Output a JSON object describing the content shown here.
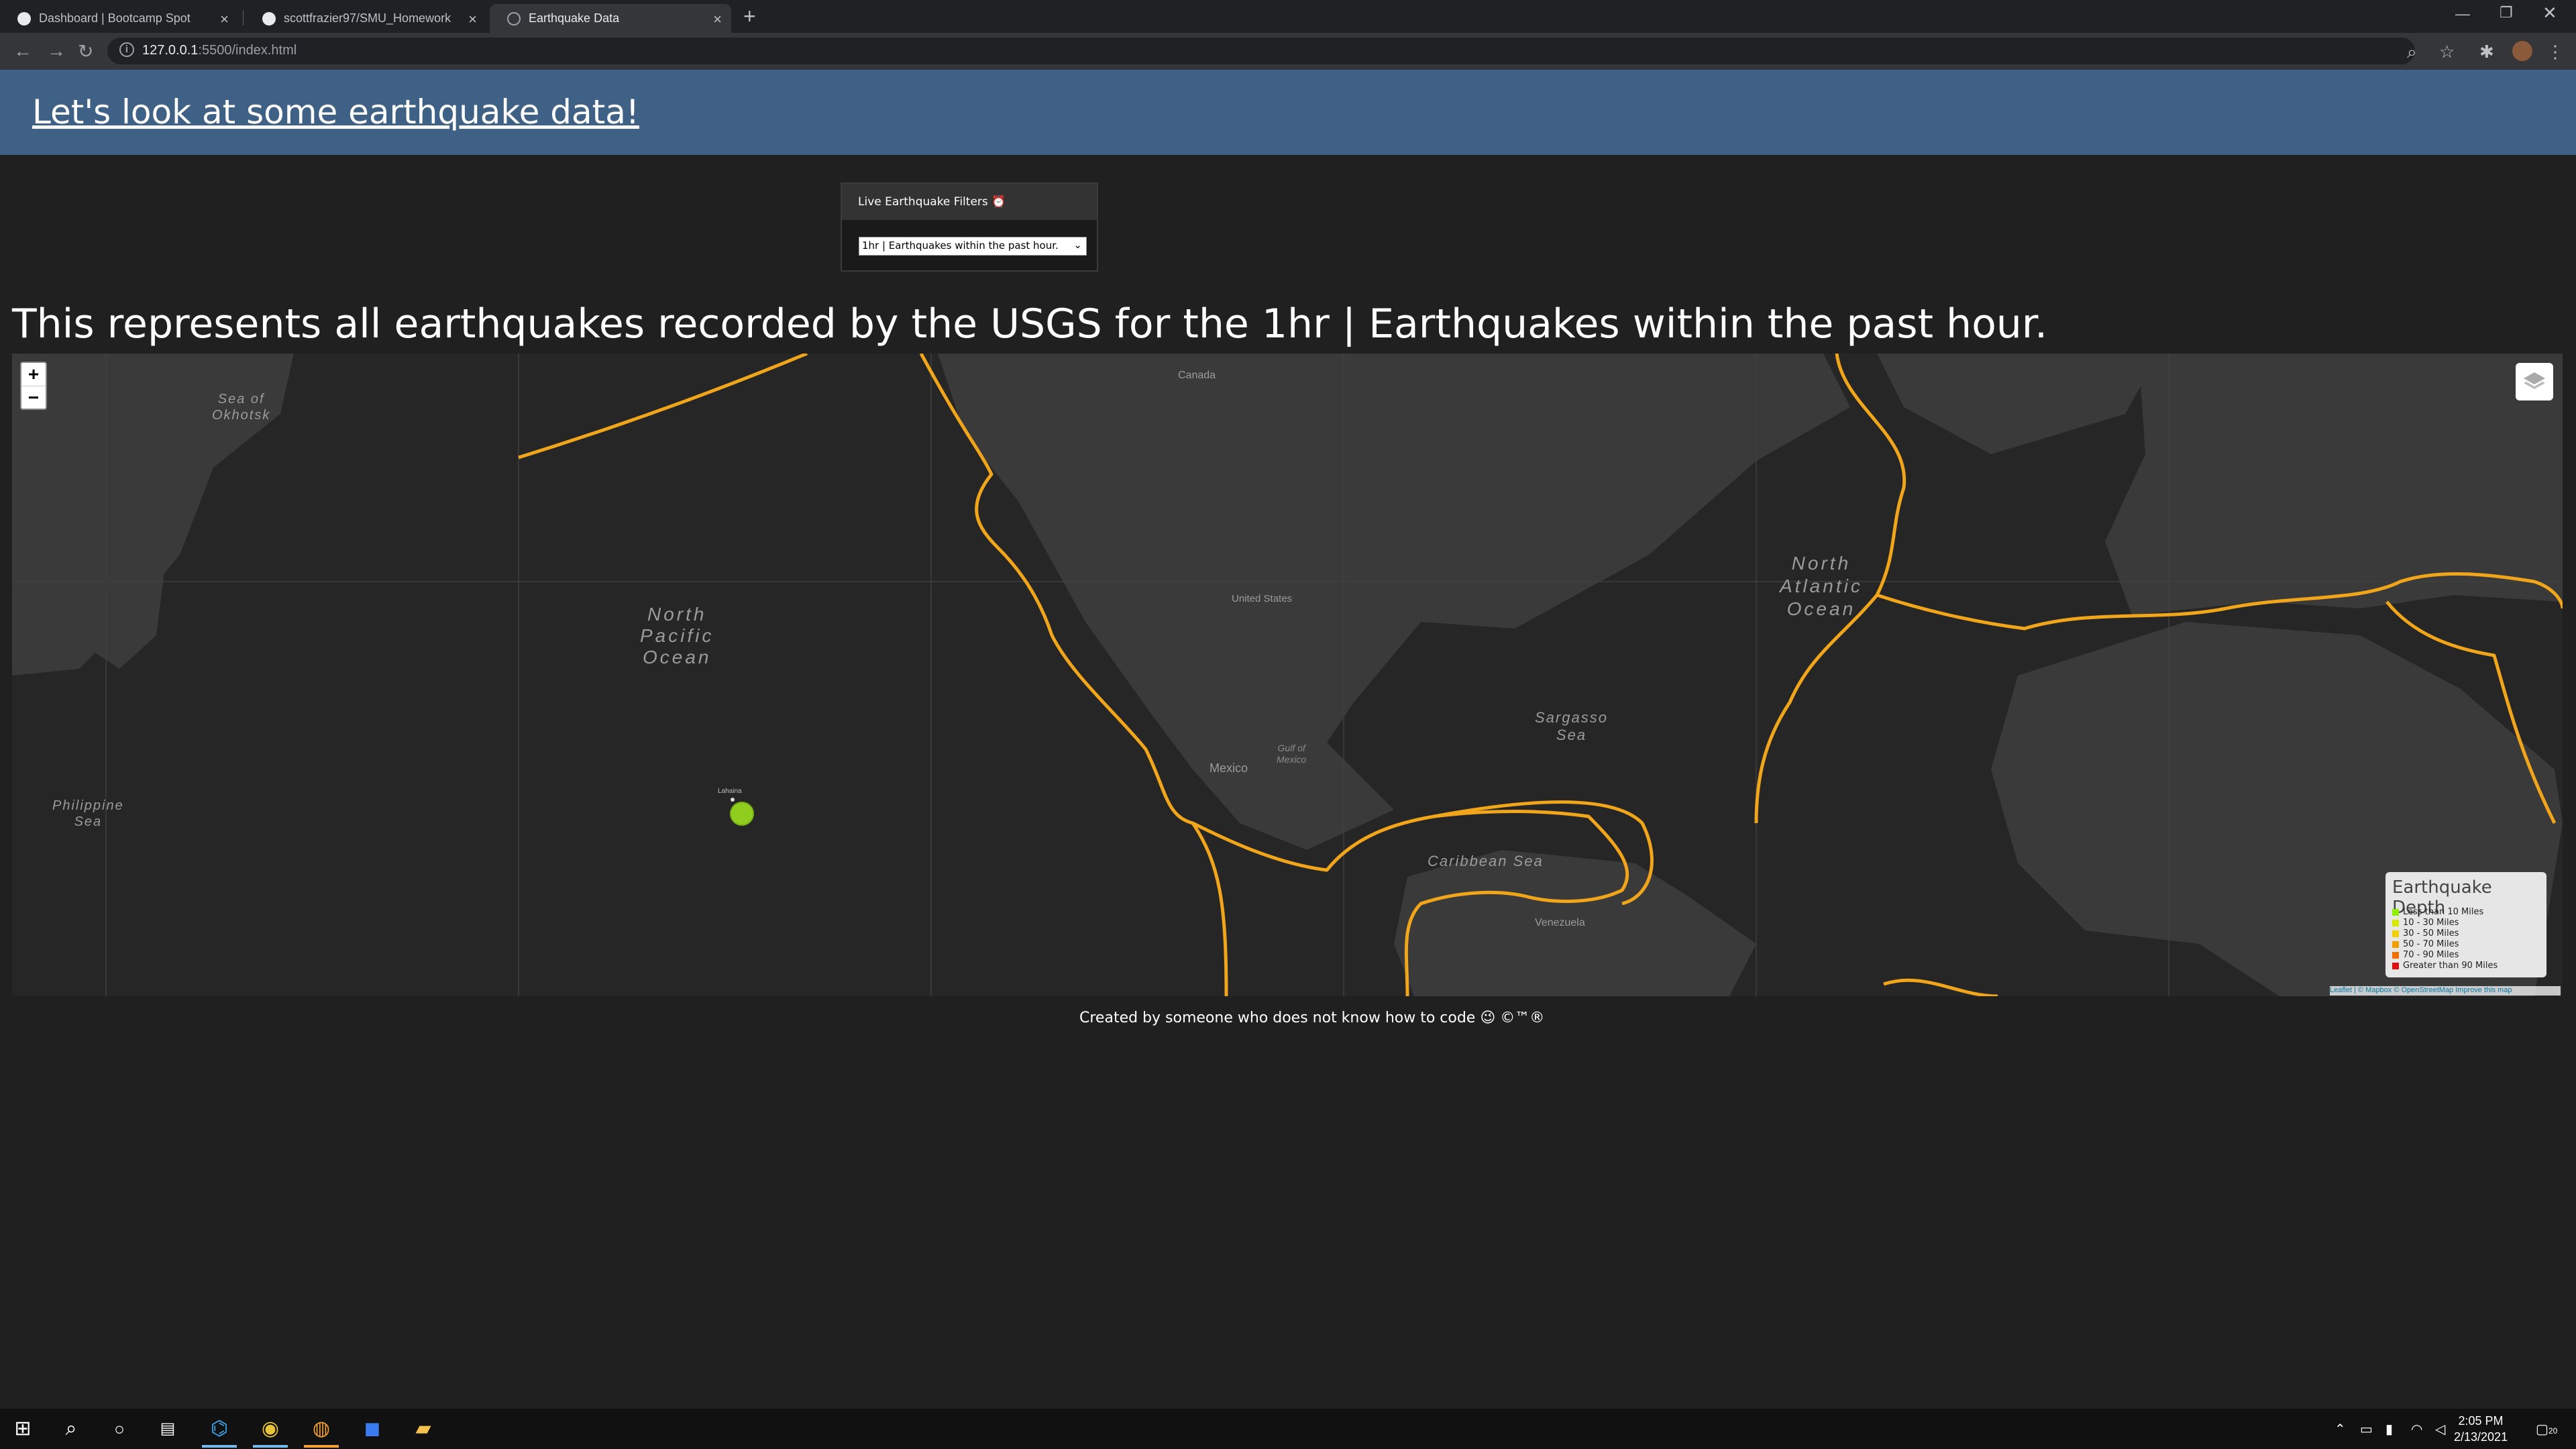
{
  "browser": {
    "tabs": [
      {
        "title": "Dashboard | Bootcamp Spot",
        "icon": "bootcamp-icon",
        "active": false
      },
      {
        "title": "scottfrazier97/SMU_Homework",
        "icon": "github-icon",
        "active": false
      },
      {
        "title": "Earthquake Data",
        "icon": "globe-icon",
        "active": true
      }
    ],
    "url_host": "127.0.0.1",
    "url_path": ":5500/index.html"
  },
  "header": {
    "title": "Let's look at some earthquake data!"
  },
  "filter": {
    "heading": "Live Earthquake Filters ⏰",
    "selected": "1hr | Earthquakes within the past hour."
  },
  "description": "This represents all earthquakes recorded by the USGS for the 1hr | Earthquakes within the past hour.",
  "map": {
    "zoom_in": "+",
    "zoom_out": "−",
    "labels": {
      "north_pacific": "North\nPacific\nOcean",
      "north_atlantic": "North\nAtlantic\nOcean",
      "sargasso": "Sargasso\nSea",
      "caribbean": "Caribbean Sea",
      "philippine": "Philippine\nSea",
      "okhotsk": "Sea of\nOkhotsk",
      "gulf_mexico": "Gulf of\nMexico",
      "mexico": "Mexico",
      "united_states": "United States",
      "canada": "Canada",
      "venezuela": "Venezuela",
      "lahaina": "Lahaina"
    },
    "legend": {
      "title": "Earthquake Depth",
      "items": [
        {
          "label": "Less than 10 Miles",
          "color": "#90ee00"
        },
        {
          "label": "10 - 30 Miles",
          "color": "#d4e800"
        },
        {
          "label": "30 - 50 Miles",
          "color": "#f0d000"
        },
        {
          "label": "50 - 70 Miles",
          "color": "#f0a000"
        },
        {
          "label": "70 - 90 Miles",
          "color": "#f07000"
        },
        {
          "label": "Greater than 90 Miles",
          "color": "#e01010"
        }
      ]
    },
    "attribution": "Leaflet | © Mapbox © OpenStreetMap Improve this map",
    "earthquake_marker_color": "#8fce1e",
    "plate_boundary_color": "#f0a51a"
  },
  "footer": "Created by someone who does not know how to code 😉 ©™®",
  "taskbar": {
    "time": "2:05 PM",
    "date": "2/13/2021",
    "notifications": "20"
  }
}
